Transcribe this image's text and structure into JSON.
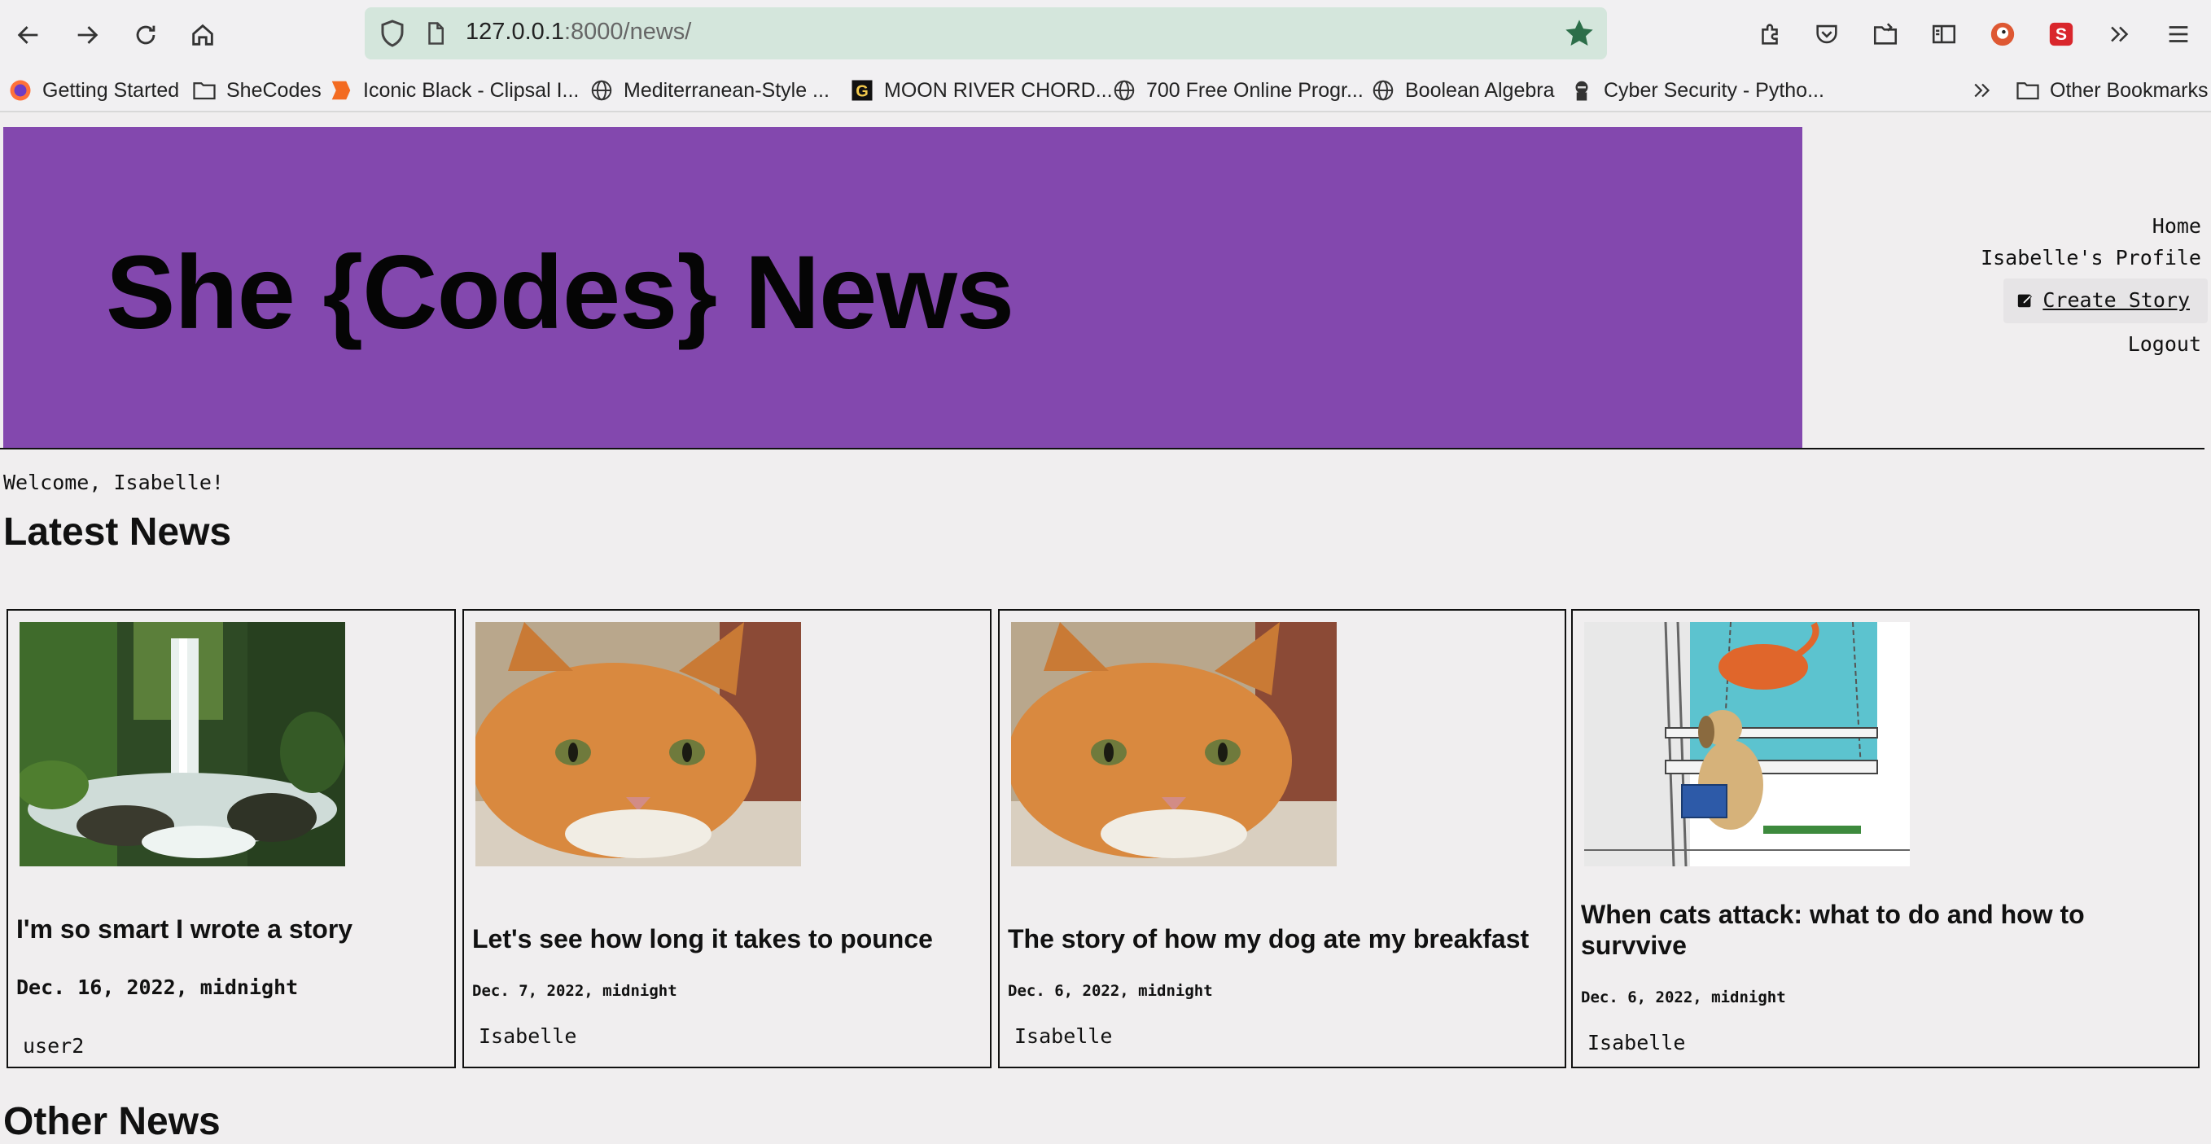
{
  "browser": {
    "url_host": "127.0.0.1",
    "url_path": ":8000/news/",
    "bookmarks": [
      {
        "label": "Getting Started",
        "icon": "firefox-icon"
      },
      {
        "label": "SheCodes",
        "icon": "folder-icon"
      },
      {
        "label": "Iconic Black - Clipsal I...",
        "icon": "clipsal-icon"
      },
      {
        "label": "Mediterranean-Style ...",
        "icon": "globe-icon"
      },
      {
        "label": "MOON RIVER CHORD...",
        "icon": "chord-site-icon"
      },
      {
        "label": "700 Free Online Progr...",
        "icon": "globe-icon"
      },
      {
        "label": "Boolean Algebra",
        "icon": "globe-icon"
      },
      {
        "label": "Cyber Security - Pytho...",
        "icon": "hacker-icon"
      }
    ],
    "other_bookmarks": "Other Bookmarks"
  },
  "site": {
    "title": "She {Codes} News",
    "nav": {
      "home": "Home",
      "profile": "Isabelle's Profile",
      "create": "Create Story",
      "logout": "Logout"
    },
    "welcome": "Welcome, Isabelle!"
  },
  "latest": {
    "heading": "Latest News",
    "stories": [
      {
        "title": "I'm so smart I wrote a story",
        "date": "Dec. 16, 2022, midnight",
        "author": "user2",
        "image": "waterfall"
      },
      {
        "title": "Let's see how long it takes to pounce",
        "date": "Dec. 7, 2022, midnight",
        "author": "Isabelle",
        "image": "orange-cat"
      },
      {
        "title": "The story of how my dog ate my breakfast",
        "date": "Dec. 6, 2022, midnight",
        "author": "Isabelle",
        "image": "orange-cat"
      },
      {
        "title": "When cats attack: what to do and how to survvive",
        "date": "Dec. 6, 2022, midnight",
        "author": "Isabelle",
        "image": "cartoon-dog-cat"
      }
    ]
  },
  "other": {
    "heading": "Other News"
  },
  "colors": {
    "banner": "#8348ae",
    "url_bar": "#d4e6dc",
    "page_bg": "#f0eeef"
  }
}
